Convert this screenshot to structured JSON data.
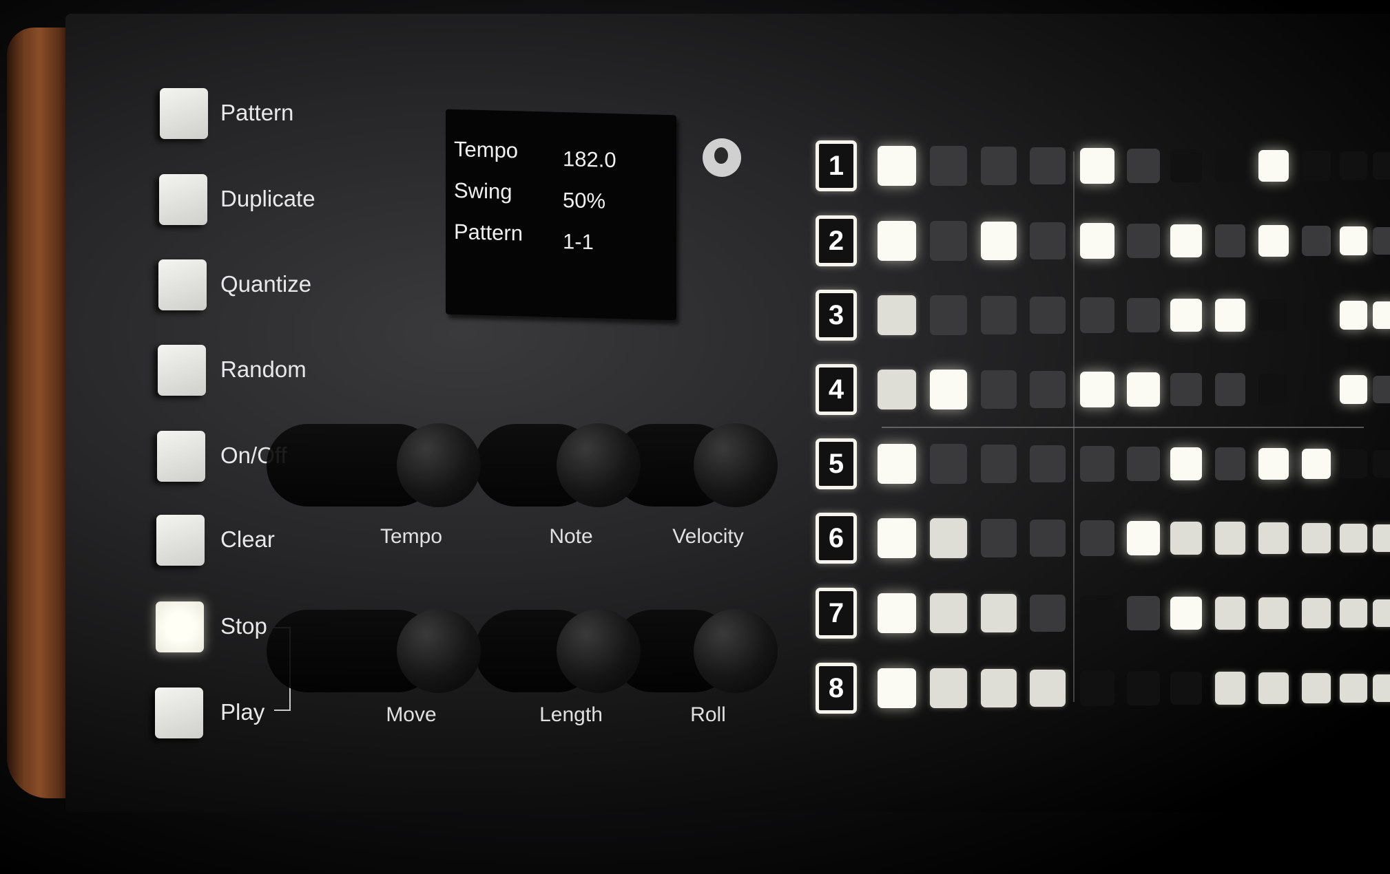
{
  "left_buttons": [
    {
      "label": "Pattern",
      "lit": false
    },
    {
      "label": "Duplicate",
      "lit": false
    },
    {
      "label": "Quantize",
      "lit": false
    },
    {
      "label": "Random",
      "lit": false
    },
    {
      "label": "On/Off",
      "lit": false
    },
    {
      "label": "Clear",
      "lit": false
    },
    {
      "label": "Stop",
      "lit": true
    },
    {
      "label": "Play",
      "lit": false
    }
  ],
  "display": {
    "rows": [
      {
        "name": "Tempo",
        "value": "182.0"
      },
      {
        "name": "Swing",
        "value": "50%"
      },
      {
        "name": "Pattern",
        "value": "1-1"
      }
    ]
  },
  "knobs": {
    "row1": [
      "Tempo",
      "Note",
      "Velocity"
    ],
    "row2": [
      "Move",
      "Length",
      "Roll"
    ]
  },
  "grid": {
    "track_numbers": [
      "1",
      "2",
      "3",
      "4",
      "5",
      "6",
      "7",
      "8"
    ],
    "pad_brightness": [
      [
        3,
        1,
        1,
        1,
        3,
        1,
        0,
        0,
        3,
        0,
        0,
        0
      ],
      [
        3,
        1,
        3,
        1,
        3,
        1,
        3,
        1,
        3,
        1,
        3,
        1
      ],
      [
        2,
        1,
        1,
        1,
        1,
        1,
        3,
        3,
        0,
        0,
        3,
        3
      ],
      [
        2,
        3,
        1,
        1,
        3,
        3,
        1,
        1,
        0,
        0,
        3,
        1
      ],
      [
        3,
        1,
        1,
        1,
        1,
        1,
        3,
        1,
        3,
        3,
        0,
        0
      ],
      [
        3,
        2,
        1,
        1,
        1,
        3,
        2,
        2,
        2,
        2,
        2,
        2
      ],
      [
        3,
        2,
        2,
        1,
        0,
        1,
        3,
        2,
        2,
        2,
        2,
        2
      ],
      [
        3,
        2,
        2,
        2,
        0,
        0,
        0,
        2,
        2,
        2,
        2,
        2
      ]
    ],
    "brightness_colors": [
      "#111112",
      "#3a3a3c",
      "#deddd6",
      "#fbfbf4"
    ]
  }
}
